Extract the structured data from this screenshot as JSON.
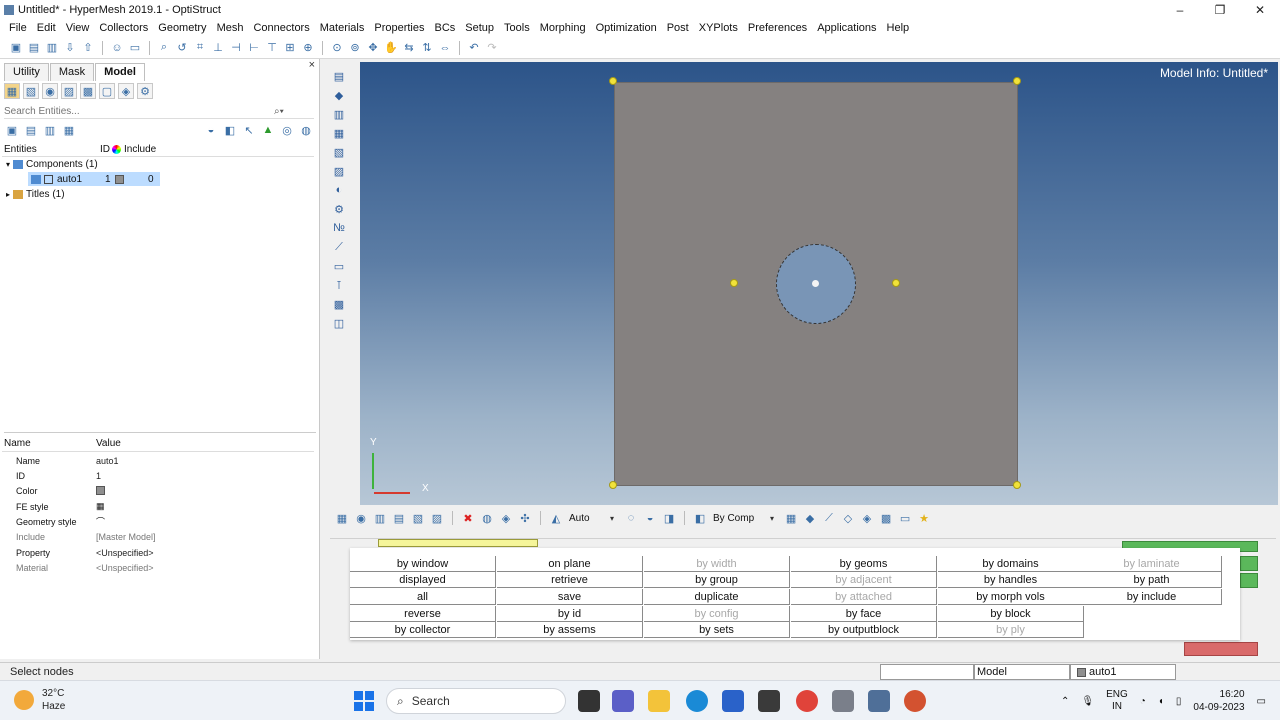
{
  "window": {
    "title": "Untitled* - HyperMesh 2019.1 - OptiStruct",
    "minimize": "–",
    "maximize": "❐",
    "close": "✕"
  },
  "menu": [
    "File",
    "Edit",
    "View",
    "Collectors",
    "Geometry",
    "Mesh",
    "Connectors",
    "Materials",
    "Properties",
    "BCs",
    "Setup",
    "Tools",
    "Morphing",
    "Optimization",
    "Post",
    "XYPlots",
    "Preferences",
    "Applications",
    "Help"
  ],
  "browser": {
    "tabs": [
      "Utility",
      "Mask",
      "Model"
    ],
    "active_tab": "Model",
    "close": "×",
    "search_placeholder": "Search Entities...",
    "columns": {
      "entities": "Entities",
      "id": "ID",
      "include": "Include"
    },
    "tree": {
      "components": "Components (1)",
      "component": {
        "name": "auto1",
        "id": "1",
        "include": "0"
      },
      "titles": "Titles (1)"
    }
  },
  "properties": {
    "header": {
      "name": "Name",
      "value": "Value"
    },
    "rows": [
      {
        "key": "Name",
        "value": "auto1"
      },
      {
        "key": "ID",
        "value": "1"
      },
      {
        "key": "Color",
        "value": ""
      },
      {
        "key": "FE style",
        "value": ""
      },
      {
        "key": "Geometry style",
        "value": ""
      },
      {
        "key": "Include",
        "value": "[Master Model]"
      },
      {
        "key": "Property",
        "value": "<Unspecified>"
      },
      {
        "key": "Material",
        "value": "<Unspecified>"
      }
    ]
  },
  "viewport": {
    "model_info": "Model Info: Untitled*",
    "axis_y": "Y",
    "axis_x": "X",
    "plate_color": "#858180",
    "node_color": "#f1e23a"
  },
  "bottom_toolbar": {
    "auto_label": "Auto",
    "color_mode": "By Comp"
  },
  "selection_popup": {
    "items": [
      [
        "by window",
        "on plane",
        "by width",
        "by geoms",
        "by domains",
        "by laminate"
      ],
      [
        "displayed",
        "retrieve",
        "by group",
        "by adjacent",
        "by handles",
        "by path"
      ],
      [
        "all",
        "save",
        "duplicate",
        "by attached",
        "by morph vols",
        "by include"
      ],
      [
        "reverse",
        "by id",
        "by config",
        "by face",
        "by block"
      ],
      [
        "by collector",
        "by assems",
        "by sets",
        "by outputblock",
        "by ply"
      ]
    ],
    "disabled": [
      "by width",
      "by laminate",
      "by adjacent",
      "by attached",
      "by config",
      "by ply"
    ]
  },
  "status": {
    "message": "Select nodes",
    "model": "Model",
    "component": "auto1"
  },
  "taskbar": {
    "temperature": "32°C",
    "weather": "Haze",
    "search": "Search",
    "lang_top": "ENG",
    "lang_bottom": "IN",
    "time": "16:20",
    "date": "04-09-2023"
  }
}
